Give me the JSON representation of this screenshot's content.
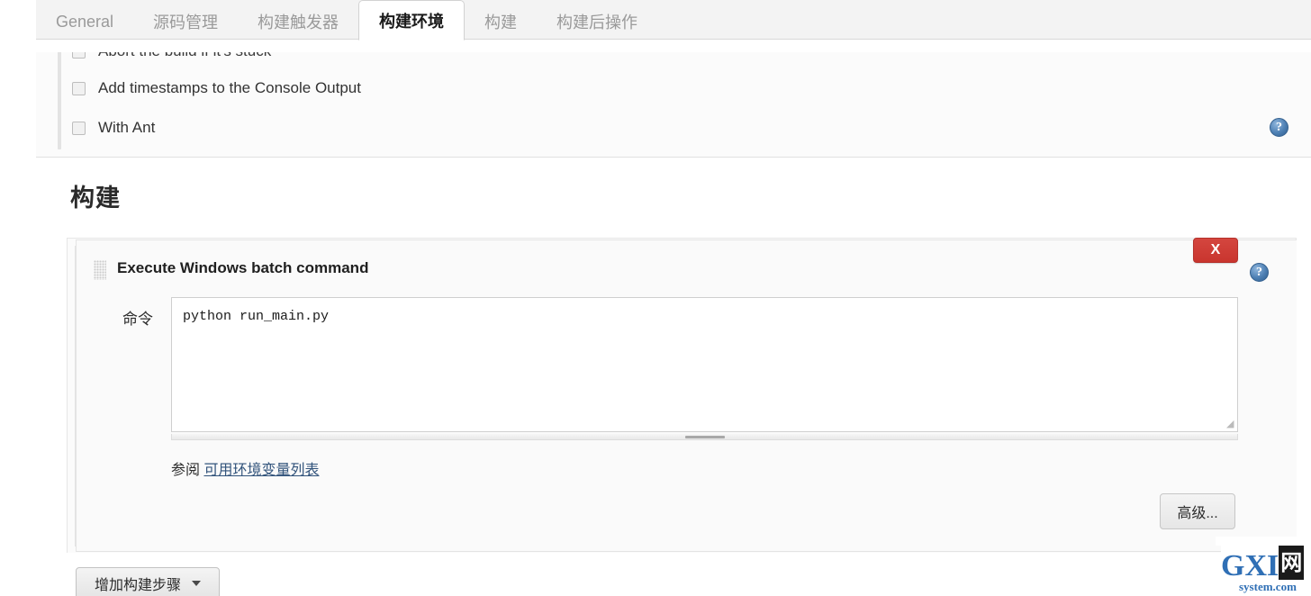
{
  "tabs": [
    {
      "label": "General",
      "active": false
    },
    {
      "label": "源码管理",
      "active": false
    },
    {
      "label": "构建触发器",
      "active": false
    },
    {
      "label": "构建环境",
      "active": true
    },
    {
      "label": "构建",
      "active": false
    },
    {
      "label": "构建后操作",
      "active": false
    }
  ],
  "build_environment": {
    "checkboxes": [
      {
        "label": "Abort the build if it's stuck",
        "checked": false
      },
      {
        "label": "Add timestamps to the Console Output",
        "checked": false
      },
      {
        "label": "With Ant",
        "checked": false
      }
    ],
    "help_icon": "help-icon"
  },
  "build_section": {
    "heading": "构建",
    "step": {
      "title": "Execute Windows batch command",
      "delete_label": "X",
      "help_icon": "help-icon",
      "drag_handle": "drag-handle-icon",
      "command_label": "命令",
      "command_value": "python run_main.py",
      "command_placeholder": "",
      "see_prefix": "参阅",
      "see_link": "可用环境变量列表",
      "advanced_label": "高级..."
    },
    "add_step_label": "增加构建步骤",
    "add_step_caret": "chevron-down-icon"
  },
  "watermark": {
    "brand_g": "G",
    "brand_xl": "XI",
    "brand_box": "网",
    "domain": "system.com"
  },
  "colors": {
    "accent_link": "#31537b",
    "danger": "#c9352e",
    "help_blue": "#4d7fb3",
    "page_bg": "#ffffff",
    "panel_bg": "#fafafa",
    "tab_bar_bg": "#f3f3f3"
  }
}
